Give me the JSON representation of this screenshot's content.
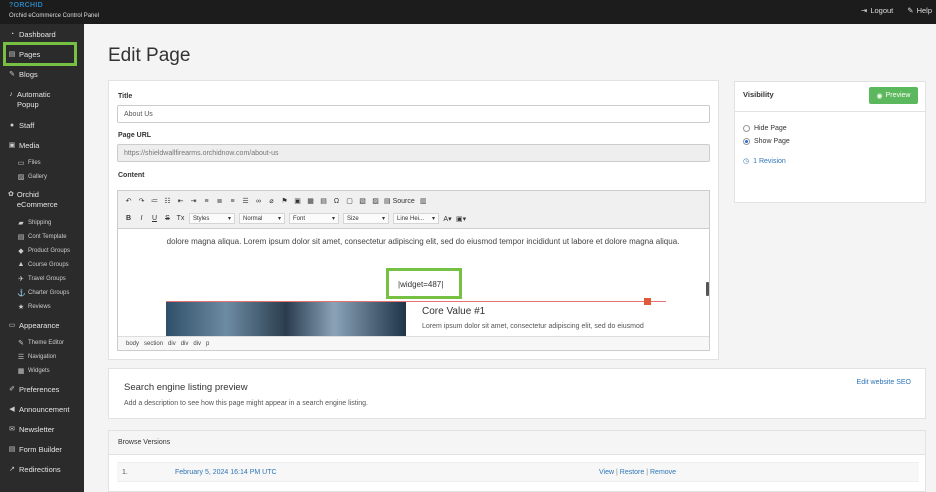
{
  "topbar": {
    "brand": "?ORCHID",
    "subtitle": "Orchid eCommerce Control Panel",
    "logout_label": "Logout",
    "help_label": "Help"
  },
  "sidebar": {
    "items": [
      {
        "label": "Dashboard",
        "icon": "dashboard-icon"
      },
      {
        "label": "Pages",
        "icon": "page-icon"
      },
      {
        "label": "Blogs",
        "icon": "pencil-icon"
      },
      {
        "label": "Automatic Popup",
        "icon": "bell-icon"
      },
      {
        "label": "Staff",
        "icon": "user-icon"
      },
      {
        "label": "Media",
        "icon": "media-icon"
      },
      {
        "label": "Orchid eCommerce",
        "icon": "orchid-icon"
      },
      {
        "label": "Appearance",
        "icon": "monitor-icon"
      },
      {
        "label": "Preferences",
        "icon": "wrench-icon"
      },
      {
        "label": "Announcement",
        "icon": "megaphone-icon"
      },
      {
        "label": "Newsletter",
        "icon": "envelope-icon"
      },
      {
        "label": "Form Builder",
        "icon": "form-icon"
      },
      {
        "label": "Redirections",
        "icon": "redirect-icon"
      }
    ],
    "media_sub": [
      "Files",
      "Gallery"
    ],
    "ecommerce_sub": [
      "Shipping",
      "Cont Template",
      "Product Groups",
      "Course Groups",
      "Travel Groups",
      "Charter Groups",
      "Reviews"
    ],
    "appearance_sub": [
      "Theme Editor",
      "Navigation",
      "Widgets"
    ]
  },
  "main": {
    "title": "Edit Page",
    "title_label": "Title",
    "title_value": "About Us",
    "url_label": "Page URL",
    "url_value": "https://shieldwallfirearms.orchidnow.com/about-us",
    "content_label": "Content"
  },
  "editor": {
    "source_label": "Source",
    "styles_label": "Styles",
    "format_label": "Normal",
    "font_label": "Font",
    "size_label": "Size",
    "lineheight_label": "Line Hei...",
    "paragraph": "dolore magna aliqua. Lorem ipsum dolor sit amet, consectetur adipiscing elit, sed do eiusmod tempor incididunt ut labore et dolore magna aliqua.",
    "widget_code": "|widget=487|",
    "core_title": "Core Value #1",
    "core_text": "Lorem ipsum dolor sit amet, consectetur adipiscing elit, sed do eiusmod",
    "path": [
      "body",
      "section",
      "div",
      "div",
      "div",
      "p"
    ]
  },
  "visibility": {
    "title": "Visibility",
    "preview_label": "Preview",
    "hide_label": "Hide Page",
    "show_label": "Show Page",
    "selected": "Show Page",
    "revision_label": "1 Revision"
  },
  "seo": {
    "title": "Search engine listing preview",
    "description": "Add a description to see how this page might appear in a search engine listing.",
    "edit_label": "Edit website SEO"
  },
  "versions": {
    "title": "Browse Versions",
    "rows": [
      {
        "num": "1.",
        "date": "February 5, 2024 16:14 PM UTC",
        "view": "View",
        "restore": "Restore",
        "remove": "Remove"
      }
    ]
  },
  "colors": {
    "highlight": "#76c043",
    "topbar": "#1c1c1c",
    "sidebar": "#2b2b2b",
    "preview_button": "#5cb85c",
    "link": "#2e75b6"
  }
}
